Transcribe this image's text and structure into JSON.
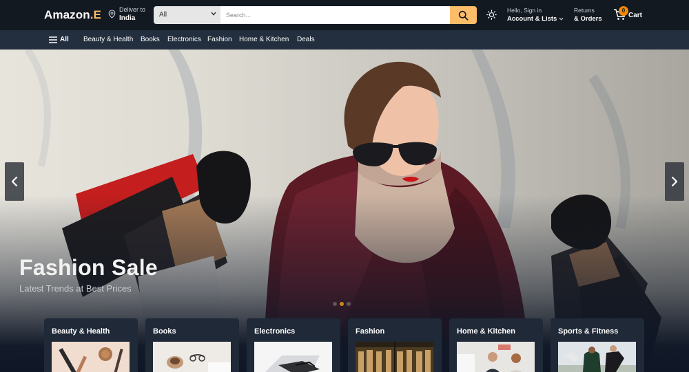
{
  "header": {
    "logo_main": "Amazon",
    "logo_accent": ".E",
    "deliver_small": "Deliver to",
    "deliver_big": "India",
    "search_category": "All",
    "search_placeholder": "Search...",
    "account_small": "Hello, Sign in",
    "account_big": "Account & Lists",
    "orders_small": "Returns",
    "orders_big": "& Orders",
    "cart_count": "0",
    "cart_label": "Cart",
    "accent": "#febd69"
  },
  "subnav": {
    "all_label": "All",
    "items": [
      "Beauty & Health",
      "Books",
      "Electronics",
      "Fashion",
      "Home & Kitchen",
      "Deals"
    ]
  },
  "hero": {
    "title": "Fashion Sale",
    "subtitle": "Latest Trends at Best Prices",
    "slide_count": 3,
    "active_slide": 2
  },
  "categories": [
    {
      "title": "Beauty & Health",
      "icon": "cosmetics-image"
    },
    {
      "title": "Books",
      "icon": "books-image"
    },
    {
      "title": "Electronics",
      "icon": "laptop-image"
    },
    {
      "title": "Fashion",
      "icon": "clothing-rack-image"
    },
    {
      "title": "Home & Kitchen",
      "icon": "kitchen-people-image"
    },
    {
      "title": "Sports & Fitness",
      "icon": "soccer-players-image"
    }
  ]
}
